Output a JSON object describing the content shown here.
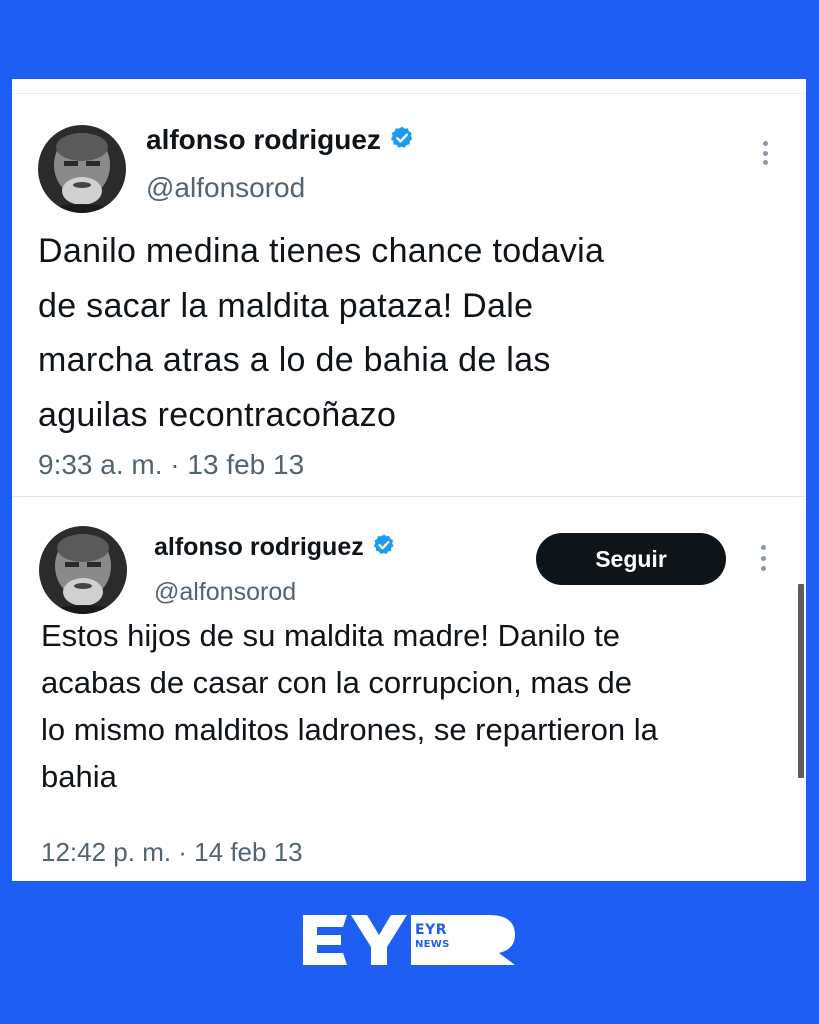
{
  "tweets": [
    {
      "author_name": "alfonso rodriguez",
      "handle": "@alfonsorod",
      "text_lines": [
        "Danilo medina tienes chance todavia",
        "de sacar la maldita pataza! Dale",
        "marcha atras a lo de bahia de las",
        "aguilas recontracoñazo"
      ],
      "timestamp": "9:33 a. m. · 13 feb 13"
    },
    {
      "author_name": "alfonso rodriguez",
      "handle": "@alfonsorod",
      "follow_label": "Seguir",
      "text_lines": [
        "Estos hijos de su maldita madre! Danilo te",
        "acabas de casar con la corrupcion, mas de",
        "lo mismo malditos ladrones, se repartieron la",
        "bahia"
      ],
      "timestamp": "12:42 p. m. · 14 feb 13"
    }
  ],
  "logo": {
    "line1": "EYR",
    "line2": "NEWS"
  },
  "colors": {
    "background": "#1e5ef3",
    "card": "#ffffff",
    "verified_badge": "#1d9bf0",
    "follow_button": "#0f1419",
    "primary_text": "#0f1419",
    "secondary_text": "#536471"
  },
  "icons": {
    "verified": "verified-badge-icon",
    "more": "more-options-icon"
  }
}
